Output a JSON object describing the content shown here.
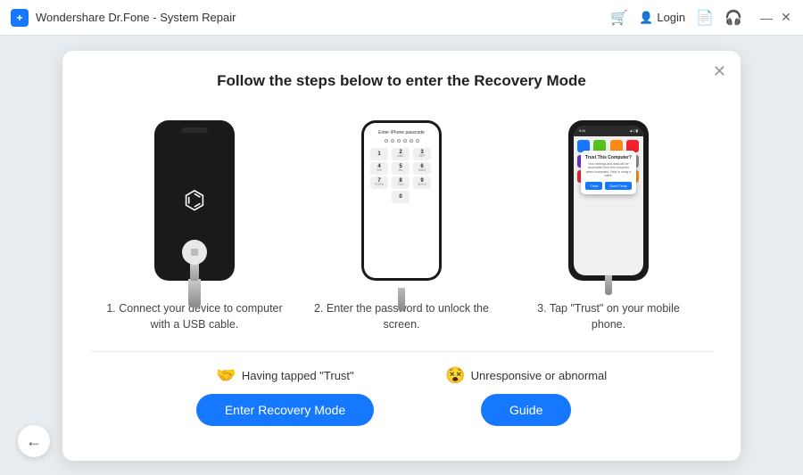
{
  "titlebar": {
    "app_name": "Wondershare Dr.Fone - System Repair",
    "login_label": "Login"
  },
  "dialog": {
    "title": "Follow the steps below to enter the Recovery Mode",
    "step1": {
      "desc": "1. Connect your device to computer with a USB cable."
    },
    "step2": {
      "desc": "2. Enter the password to unlock the screen."
    },
    "step3": {
      "desc": "3. Tap \"Trust\" on your mobile phone."
    },
    "trust_dialog": {
      "title": "Trust This Computer?",
      "desc": "Your settings and data will be accessible from this computer when connected. Help in using a cable.",
      "trust_btn": "Trust",
      "dont_trust_btn": "Don't Trust"
    }
  },
  "actions": {
    "trust_label": "Having tapped \"Trust\"",
    "unresponsive_label": "Unresponsive or abnormal",
    "enter_recovery_btn": "Enter Recovery Mode",
    "guide_btn": "Guide"
  },
  "numpad": [
    {
      "main": "1",
      "sub": ""
    },
    {
      "main": "2",
      "sub": "ABC"
    },
    {
      "main": "3",
      "sub": "DEF"
    },
    {
      "main": "4",
      "sub": "GHI"
    },
    {
      "main": "5",
      "sub": "JKL"
    },
    {
      "main": "6",
      "sub": "MNO"
    },
    {
      "main": "7",
      "sub": "PQRS"
    },
    {
      "main": "8",
      "sub": "TUV"
    },
    {
      "main": "9",
      "sub": "WXYZ"
    },
    {
      "main": "0",
      "sub": ""
    }
  ],
  "passcode_label": "Enter iPhone passcode",
  "status": {
    "time": "9:41",
    "icons": "▲ ⬡ ▮"
  }
}
